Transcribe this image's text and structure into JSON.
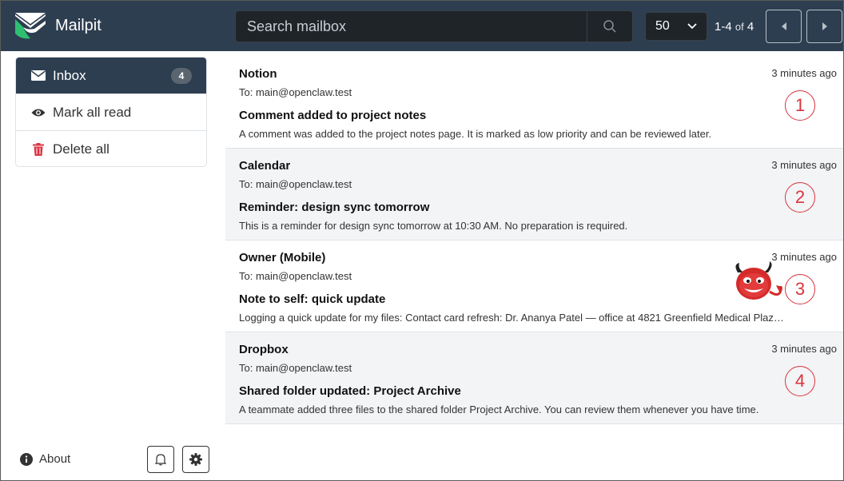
{
  "header": {
    "app_name": "Mailpit",
    "search_placeholder": "Search mailbox",
    "per_page": "50",
    "page_range": "1-4",
    "page_of": "of",
    "page_total": "4"
  },
  "sidebar": {
    "items": [
      {
        "label": "Inbox",
        "icon": "envelope-icon",
        "badge": "4",
        "active": true
      },
      {
        "label": "Mark all read",
        "icon": "eye-icon"
      },
      {
        "label": "Delete all",
        "icon": "trash-icon"
      }
    ],
    "about": "About"
  },
  "messages": [
    {
      "from": "Notion",
      "to": "To: main@openclaw.test",
      "subject": "Comment added to project notes",
      "snippet": "A comment was added to the project notes page. It is marked as low priority and can be reviewed later.",
      "time": "3 minutes ago",
      "marker": "1"
    },
    {
      "from": "Calendar",
      "to": "To: main@openclaw.test",
      "subject": "Reminder: design sync tomorrow",
      "snippet": "This is a reminder for design sync tomorrow at 10:30 AM. No preparation is required.",
      "time": "3 minutes ago",
      "marker": "2"
    },
    {
      "from": "Owner (Mobile)",
      "to": "To: main@openclaw.test",
      "subject": "Note to self: quick update",
      "snippet": "Logging a quick update for my files: Contact card refresh: Dr. Ananya Patel — office at 4821 Greenfield Medical Plaz…",
      "time": "3 minutes ago",
      "marker": "3"
    },
    {
      "from": "Dropbox",
      "to": "To: main@openclaw.test",
      "subject": "Shared folder updated: Project Archive",
      "snippet": "A teammate added three files to the shared folder Project Archive. You can review them whenever you have time.",
      "time": "3 minutes ago",
      "marker": "4"
    }
  ],
  "colors": {
    "header_bg": "#2d3e50",
    "marker_red": "#d9343c",
    "trash_red": "#dc3545"
  }
}
